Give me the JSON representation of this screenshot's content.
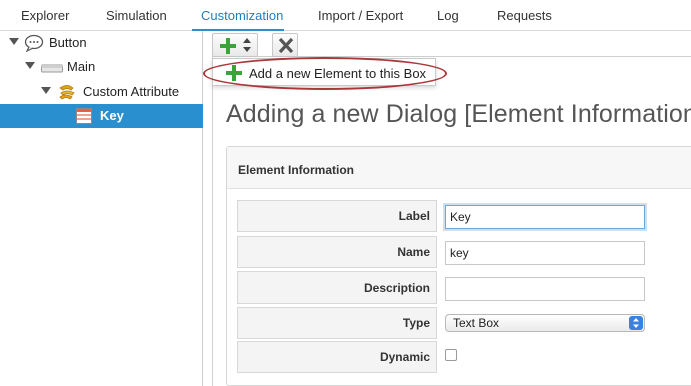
{
  "tabs": [
    {
      "label": "Explorer",
      "active": false
    },
    {
      "label": "Simulation",
      "active": false
    },
    {
      "label": "Customization",
      "active": true
    },
    {
      "label": "Import / Export",
      "active": false
    },
    {
      "label": "Log",
      "active": false
    },
    {
      "label": "Requests",
      "active": false
    }
  ],
  "tree": {
    "items": [
      {
        "label": "Button",
        "icon": "speech-bubble-icon",
        "expanded": true
      },
      {
        "label": "Main",
        "icon": "form-bar-icon",
        "expanded": true
      },
      {
        "label": "Custom Attribute",
        "icon": "custom-attribute-icon",
        "expanded": true
      },
      {
        "label": "Key",
        "icon": "text-box-icon",
        "selected": true
      }
    ]
  },
  "toolbar": {
    "add_icon": "plus-icon",
    "sort_icon": "up-down-arrow-icon",
    "remove_icon": "close-x-icon"
  },
  "popup": {
    "label": "Add a new Element to this Box",
    "icon": "plus-icon"
  },
  "heading": "Adding a new Dialog [Element Information]",
  "panel": {
    "title": "Element Information",
    "fields": {
      "label": {
        "label": "Label",
        "value": "Key"
      },
      "name": {
        "label": "Name",
        "value": "key"
      },
      "description": {
        "label": "Description",
        "value": ""
      },
      "type": {
        "label": "Type",
        "value": "Text Box"
      },
      "dynamic": {
        "label": "Dynamic",
        "checked": false
      }
    }
  },
  "colors": {
    "accent": "#2a8fce",
    "active_tab": "#1f7fb8",
    "highlight_ellipse": "#a8383a",
    "plus_green": "#3aa33a"
  }
}
